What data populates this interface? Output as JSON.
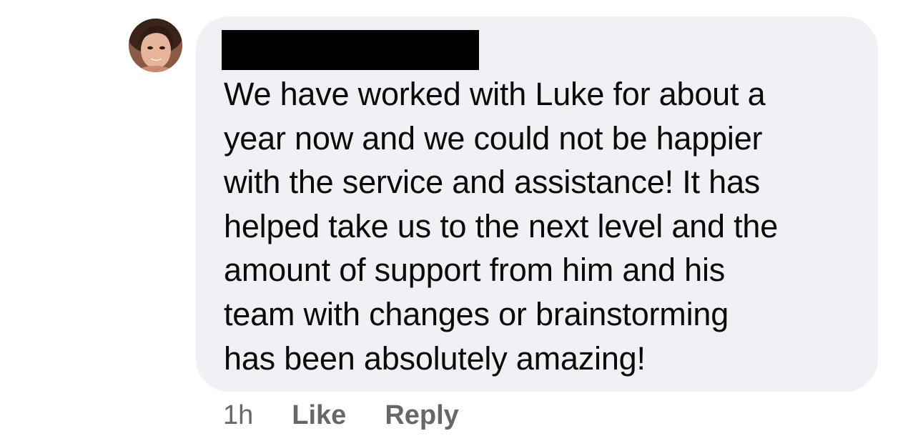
{
  "comment": {
    "author": {
      "name": "",
      "avatar_icon": "user-avatar-photo"
    },
    "text_lines": [
      "We have worked with Luke for about a",
      "year now and we could not be happier",
      "with the service and assistance! It has",
      "helped take us to the next level and the",
      "amount of support from him and his",
      "team with changes or brainstorming",
      "has been absolutely amazing!"
    ],
    "actions": {
      "timestamp": "1h",
      "like_label": "Like",
      "reply_label": "Reply"
    }
  },
  "colors": {
    "bubble_background": "#f0f1f5",
    "text": "#0a0a0a",
    "action_text": "#65676b",
    "redaction": "#000000"
  }
}
